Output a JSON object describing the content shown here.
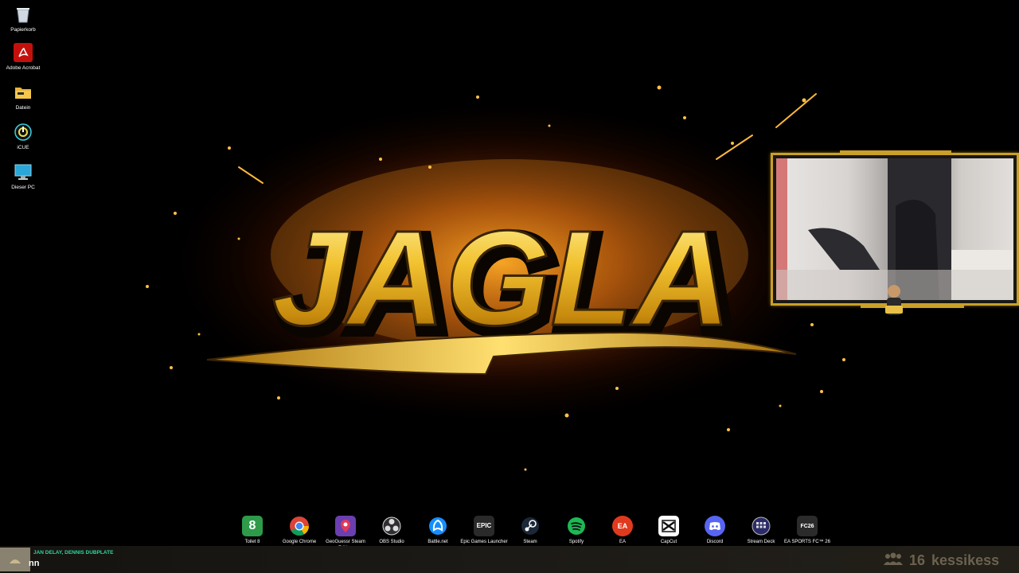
{
  "desktop_icons": [
    {
      "label": "Papierkorb",
      "icon": "recycle-bin-icon"
    },
    {
      "label": "Adobe Acrobat",
      "icon": "acrobat-icon"
    },
    {
      "label": "Datein",
      "icon": "folder-icon"
    },
    {
      "label": "iCUE",
      "icon": "icue-icon"
    },
    {
      "label": "Dieser PC",
      "icon": "monitor-icon"
    }
  ],
  "wallpaper": {
    "logo_text": "JAGLA"
  },
  "dock": [
    {
      "label": "Toilet 8",
      "icon": "toilet8-icon",
      "glyph": "8",
      "color": "#2e9a4a"
    },
    {
      "label": "Google Chrome",
      "icon": "chrome-icon",
      "color": "#4285f4"
    },
    {
      "label": "GeoGuessr Steam Edition",
      "icon": "geoguessr-icon",
      "color": "#6a3fb0"
    },
    {
      "label": "OBS Studio",
      "icon": "obs-icon",
      "color": "#302e31"
    },
    {
      "label": "Battle.net",
      "icon": "battlenet-icon",
      "color": "#148eff"
    },
    {
      "label": "Epic Games Launcher",
      "icon": "epic-games-icon",
      "glyph": "EPIC",
      "color": "#2a2a2a"
    },
    {
      "label": "Steam",
      "icon": "steam-icon",
      "color": "#1b2838"
    },
    {
      "label": "Spotify",
      "icon": "spotify-icon",
      "color": "#1db954"
    },
    {
      "label": "EA",
      "icon": "ea-icon",
      "glyph": "EA",
      "color": "#e03a1e"
    },
    {
      "label": "CapCut",
      "icon": "capcut-icon",
      "color": "#111111"
    },
    {
      "label": "Discord",
      "icon": "discord-icon",
      "color": "#5865f2"
    },
    {
      "label": "Stream Deck",
      "icon": "stream-deck-icon",
      "color": "#2b2b6a"
    },
    {
      "label": "EA SPORTS FC™ 26",
      "icon": "ea-fc-icon",
      "glyph": "FC26",
      "color": "#2b2b2b"
    }
  ],
  "now_playing": {
    "artist": "JAN DELAY, DENNIS DUBPLATE",
    "title": "nn"
  },
  "stream": {
    "viewer_count": "16",
    "channel": "kessikess"
  },
  "colors": {
    "accent_gold": "#c9a028",
    "spotify_green": "#2fd6a2"
  }
}
